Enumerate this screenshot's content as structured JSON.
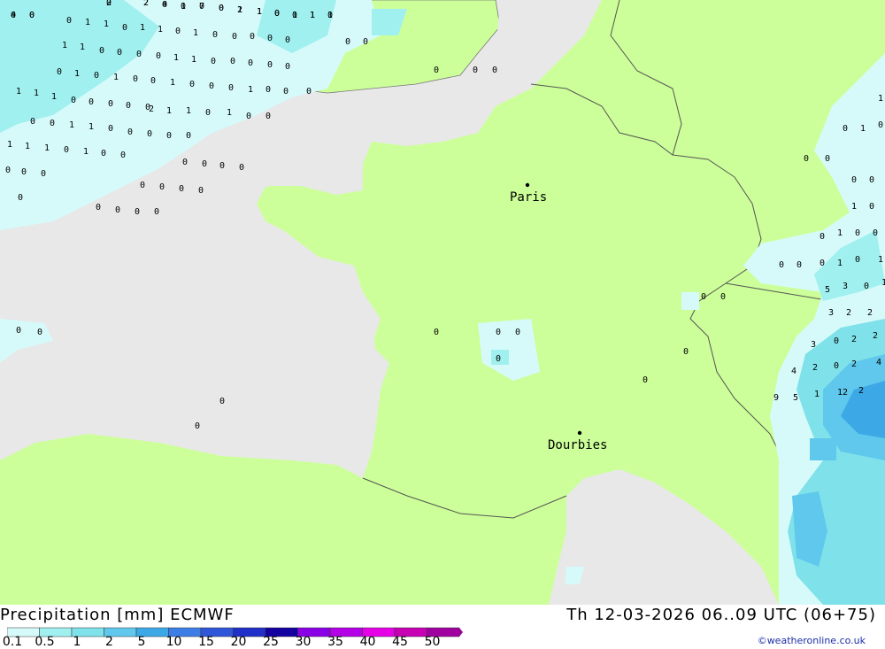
{
  "title": "Precipitation [mm] ECMWF",
  "valid_time": "Th 12-03-2026 06..09 UTC (06+75)",
  "credit": "©weatheronline.co.uk",
  "colors": {
    "sea": "#e8e8e8",
    "land": "#ccff99",
    "border": "#555555",
    "precip_0_1": "#d6fafa",
    "precip_0_5": "#a0f0f0",
    "precip_1": "#7fe1e9",
    "precip_2": "#5fc8ec",
    "precip_5": "#3c96e6"
  },
  "scale": {
    "labels": [
      "0.1",
      "0.5",
      "1",
      "2",
      "5",
      "10",
      "15",
      "20",
      "25",
      "30",
      "35",
      "40",
      "45",
      "50"
    ],
    "colors": [
      "#d6fafa",
      "#a0f0f0",
      "#7fe1e9",
      "#5fc8ec",
      "#3ca9e6",
      "#3c7ee6",
      "#2f55d8",
      "#1f2fc8",
      "#1400a0",
      "#8a00e6",
      "#b400e6",
      "#e600e6",
      "#c800b4",
      "#a000a0"
    ]
  },
  "cities": [
    {
      "name": "Paris",
      "icon": "city-dot-icon"
    },
    {
      "name": "Dourbies",
      "icon": "city-dot-icon"
    }
  ],
  "grid_values": [
    "0",
    "0",
    "0",
    "2",
    "0",
    "0",
    "0",
    "0",
    "1",
    "1",
    "0",
    "1",
    "1",
    "0",
    "0",
    "1",
    "1",
    "0",
    "1",
    "1",
    "0",
    "1",
    "0",
    "0",
    "0",
    "0",
    "0",
    "1",
    "1",
    "0",
    "0",
    "0",
    "0",
    "1",
    "1",
    "0",
    "0",
    "0",
    "0",
    "0",
    "0",
    "1",
    "0",
    "1",
    "0",
    "0",
    "1",
    "0",
    "0",
    "0",
    "1",
    "0",
    "0",
    "0",
    "1",
    "1",
    "1",
    "0",
    "0",
    "0",
    "0",
    "0",
    "2",
    "1",
    "1",
    "0",
    "1",
    "0",
    "0",
    "0",
    "0",
    "1",
    "1",
    "0",
    "0",
    "0",
    "0",
    "0",
    "1",
    "1",
    "1",
    "0",
    "1",
    "0",
    "0",
    "0",
    "0",
    "0",
    "0",
    "0",
    "0",
    "0",
    "0",
    "0",
    "0",
    "0",
    "0",
    "0",
    "0",
    "0",
    "0",
    "0",
    "0",
    "0",
    "0",
    "0",
    "0",
    "0",
    "0",
    "0",
    "0",
    "0",
    "0",
    "0",
    "0",
    "0",
    "0",
    "0",
    "0",
    "0",
    "0",
    "1",
    "0",
    "1",
    "0",
    "0",
    "1",
    "0",
    "1",
    "0",
    "0",
    "0",
    "0",
    "0",
    "0",
    "1",
    "0",
    "1",
    "5",
    "3",
    "0",
    "1",
    "3",
    "2",
    "2",
    "0",
    "2",
    "2",
    "3",
    "4",
    "2",
    "0",
    "2",
    "4",
    "9",
    "5",
    "1",
    "12",
    "2",
    "4",
    "0",
    "2",
    "2",
    "4",
    "1",
    "7",
    "0",
    "2",
    "1",
    "0",
    "0",
    "1",
    "1"
  ]
}
